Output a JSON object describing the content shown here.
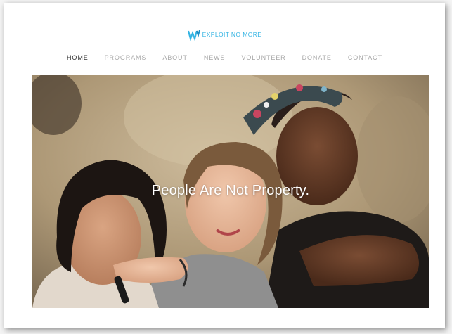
{
  "brand": {
    "name": "EXPLOIT NO MORE",
    "logo_icon": "stylized-wave-icon",
    "accent_color": "#35b4e3"
  },
  "nav": {
    "items": [
      {
        "label": "HOME",
        "active": true
      },
      {
        "label": "PROGRAMS",
        "active": false
      },
      {
        "label": "ABOUT",
        "active": false
      },
      {
        "label": "NEWS",
        "active": false
      },
      {
        "label": "VOLUNTEER",
        "active": false
      },
      {
        "label": "DONATE",
        "active": false
      },
      {
        "label": "CONTACT",
        "active": false
      }
    ]
  },
  "hero": {
    "headline": "People Are Not Property.",
    "image": "photo of three young women posing together"
  }
}
